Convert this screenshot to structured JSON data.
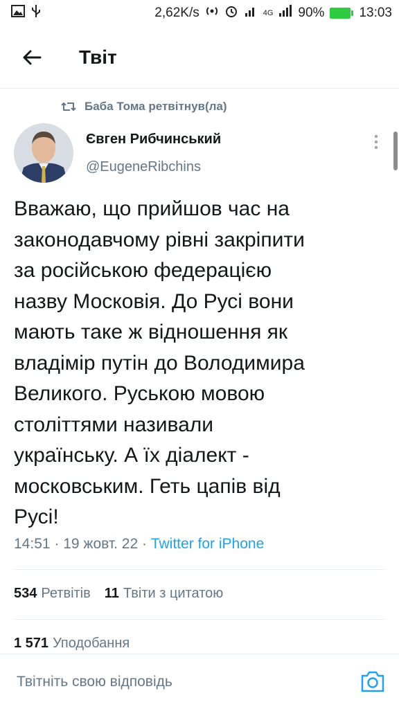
{
  "status_bar": {
    "speed": "2,62K/s",
    "network": "4G",
    "battery": "90%",
    "time": "13:03"
  },
  "header": {
    "title": "Твіт"
  },
  "retweet_context": {
    "text": "Баба Тома ретвітнув(ла)"
  },
  "author": {
    "name": "Євген Рибчинський",
    "handle": "@EugeneRibchins"
  },
  "tweet": {
    "text": "Вважаю, що прийшов час на\nзаконодавчому рівні закріпити\nза російською федерацією\nназву Московія. До Русі вони\nмають таке ж відношення як\nвладімір путін до Володимира\nВеликого. Руською мовою\nстоліттями називали\nукраїнську. А їх діалект -\nмосковським. Геть цапів від\nРусі!",
    "time": "14:51",
    "date": "19 жовт. 22",
    "source": "Twitter for iPhone",
    "separator": " · "
  },
  "stats": {
    "retweets_count": "534",
    "retweets_label": "Ретвітів",
    "quotes_count": "11",
    "quotes_label": "Твіти з цитатою",
    "likes_count": "1 571",
    "likes_label": "Уподобання"
  },
  "reply": {
    "placeholder": "Твітніть свою відповідь"
  },
  "colors": {
    "accent": "#1da1f2",
    "secondary_text": "#657786",
    "primary_text": "#14171a",
    "battery": "#2ecc40"
  }
}
